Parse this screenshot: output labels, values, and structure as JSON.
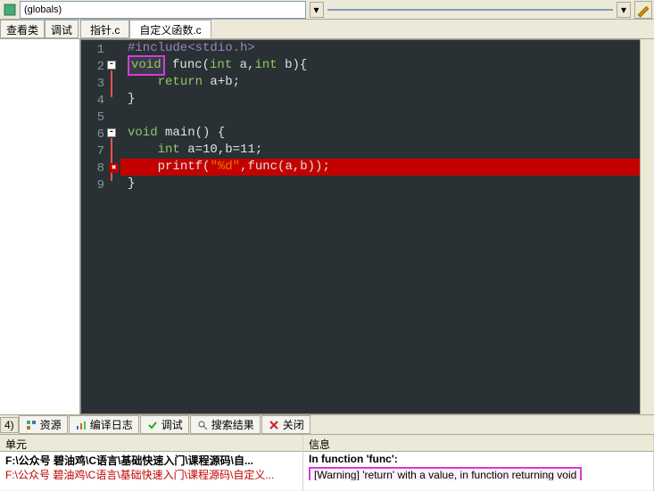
{
  "top": {
    "globals": "(globals)",
    "combo2": ""
  },
  "left_tabs": {
    "view": "查看类",
    "debug": "调试"
  },
  "file_tabs": {
    "t1": "指针.c",
    "t2": "自定义函数.c"
  },
  "code": {
    "l1": {
      "pp": "#include",
      "rest": "<stdio.h>"
    },
    "l2": {
      "kw": "void",
      "sp": " ",
      "fn": "func",
      "p1": "(",
      "t1": "int",
      "a1": " a,",
      "t2": "int",
      "a2": " b){"
    },
    "l3": {
      "indent": "    ",
      "kw": "return",
      "rest": " a+b;"
    },
    "l4": "}",
    "l5": "",
    "l6": {
      "kw": "void",
      "sp": " ",
      "fn": "main",
      "rest": "() {"
    },
    "l7": {
      "indent": "    ",
      "kw": "int",
      "rest": " a=10,b=11;"
    },
    "l8": {
      "indent": "    ",
      "fn": "printf",
      "p1": "(",
      "str": "\"%d\"",
      "rest": ",func(a,b));"
    },
    "l9": "}",
    "nums": {
      "1": "1",
      "2": "2",
      "3": "3",
      "4": "4",
      "5": "5",
      "6": "6",
      "7": "7",
      "8": "8",
      "9": "9"
    }
  },
  "bottom": {
    "num": "4)",
    "tabs": {
      "res": "资源",
      "log": "编译日志",
      "dbg": "调试",
      "search": "搜索结果",
      "close": "关闭"
    },
    "col_unit": "单元",
    "col_info": "信息",
    "unit_r1": "F:\\公众号 碧油鸡\\C语言\\基础快速入门\\课程源码\\自...",
    "unit_r2": "F:\\公众号 碧油鸡\\C语言\\基础快速入门\\课程源码\\自定义...",
    "info_r1": "In function 'func':",
    "info_r2": "[Warning] 'return' with a value, in function returning void"
  }
}
